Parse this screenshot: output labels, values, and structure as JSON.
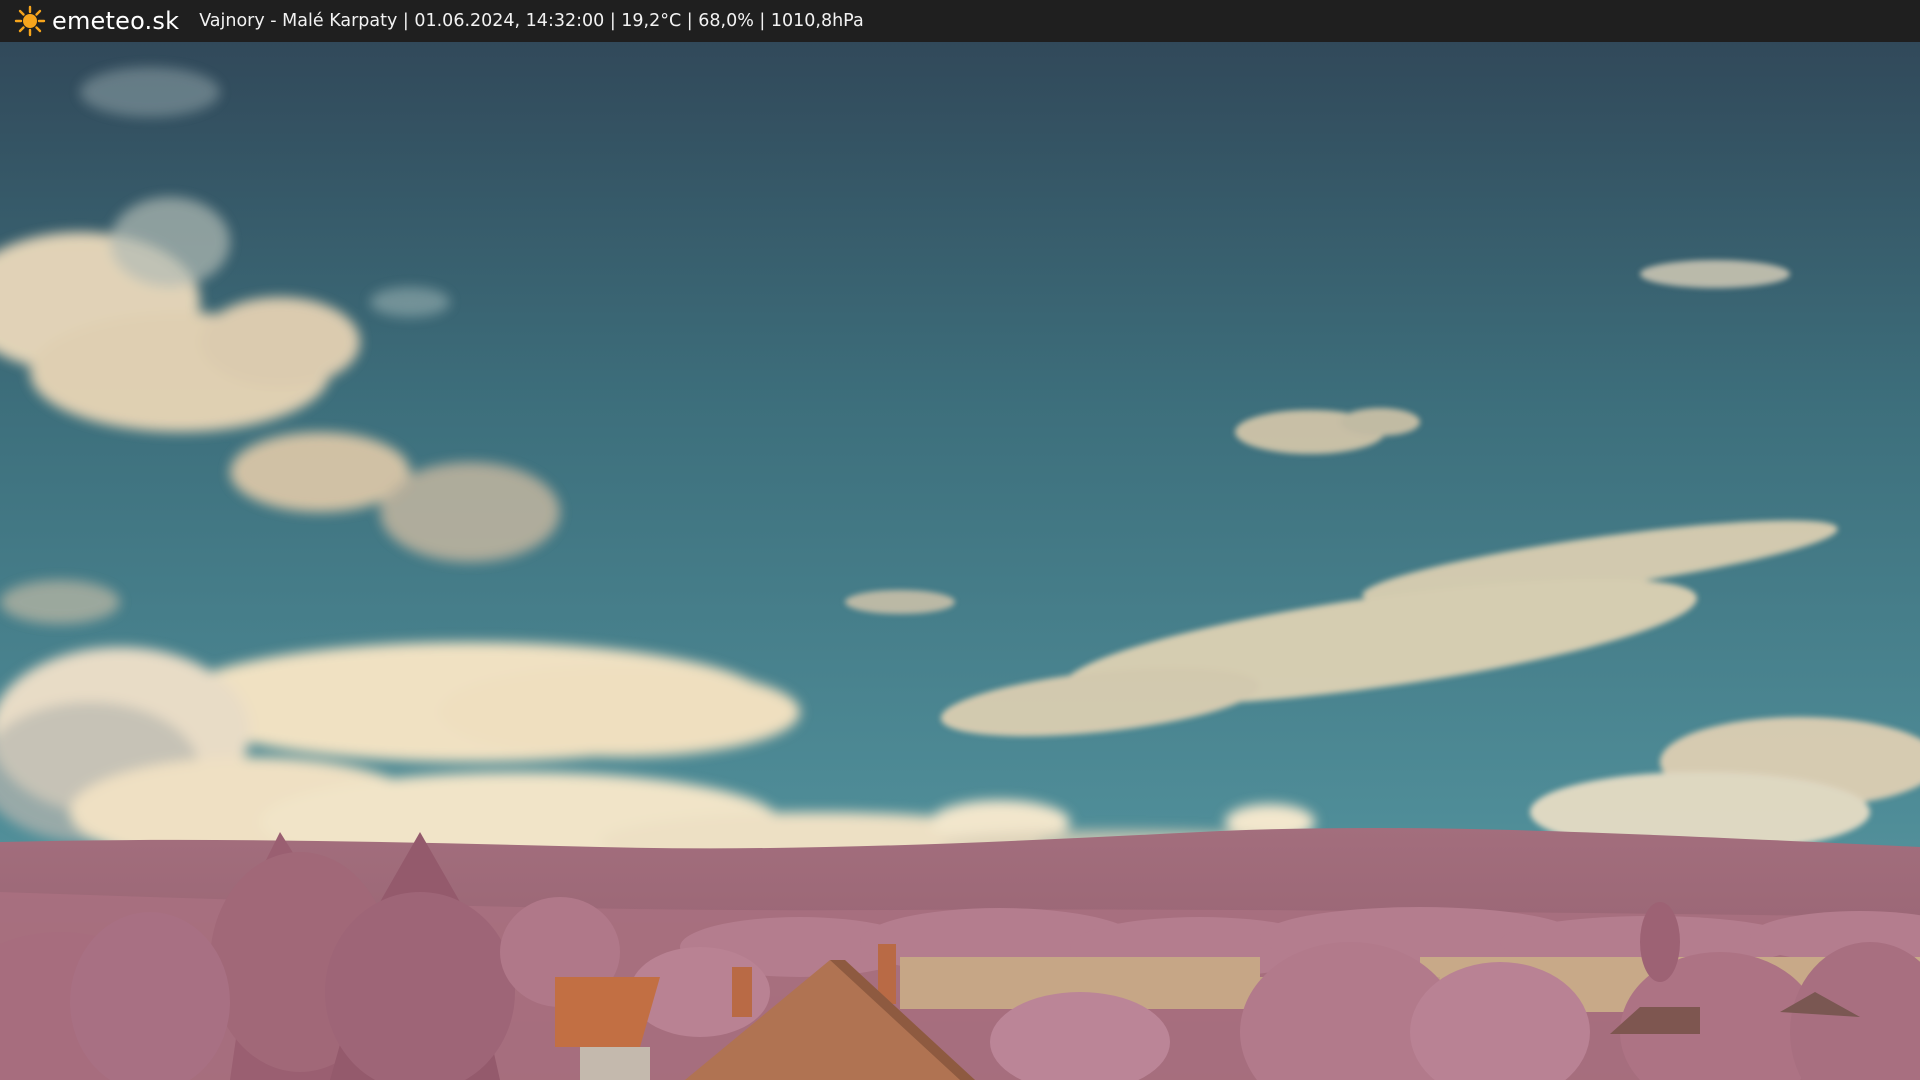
{
  "header": {
    "brand": "emeteo.sk",
    "info": "Vajnory - Malé Karpaty | 01.06.2024, 14:32:00 | 19,2°C | 68,0% | 1010,8hPa",
    "logo_icon": "sun-icon"
  },
  "scene": {
    "image_description_icon": "webcam-landscape-image"
  },
  "colors": {
    "bar": "#1f1f1f",
    "sun": "#f7a51c",
    "sky_top": "#2f4a58",
    "sky_bottom": "#4f8d98",
    "cloud": "#f0e3c6",
    "hill": "#a6707e",
    "foliage": "#b77b8c",
    "roof": "#b0663e",
    "field": "#c9a889"
  }
}
